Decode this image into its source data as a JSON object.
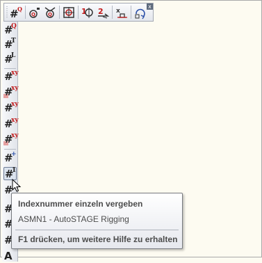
{
  "toolbar_horizontal": {
    "buttons": [
      {
        "name": "index-q-button",
        "hash": "#",
        "sup": "Q"
      },
      {
        "name": "tag-q-button",
        "hash": "",
        "sup": "Q"
      },
      {
        "name": "tag-q-arrow-button",
        "hash": "",
        "sup": "Q"
      },
      {
        "name": "target-button",
        "hash": "",
        "sup": ""
      },
      {
        "name": "number-tag-button",
        "hash": "",
        "sup": ""
      },
      {
        "name": "number-tag-2-button",
        "hash": "",
        "sup": ""
      },
      {
        "name": "axis-tag-button",
        "hash": "",
        "sup": ""
      },
      {
        "name": "refresh-tag-button",
        "hash": "",
        "sup": ""
      }
    ],
    "close_label": "x"
  },
  "toolbar_vertical": {
    "buttons": [
      {
        "hash": "#",
        "sup": "Q",
        "sup_color": "red"
      },
      {
        "hash": "#",
        "sup": "T",
        "sup_color": "dark"
      },
      {
        "hash": "#",
        "sup": "L",
        "sup_color": "dark"
      },
      {
        "hash": "#",
        "sup": "xy",
        "sup_color": "red"
      },
      {
        "hash": "#",
        "sup": "xy",
        "sup_color": "red"
      },
      {
        "hash": "#",
        "sup": "xy",
        "sup_color": "red"
      },
      {
        "hash": "#",
        "sup": "xy",
        "sup_color": "red"
      },
      {
        "hash": "#",
        "sup": "xy",
        "sup_color": "red"
      },
      {
        "hash": "#",
        "sup": "+",
        "sup_color": "blue"
      },
      {
        "hash": "#",
        "sup": "1",
        "sup_color": "dark"
      },
      {
        "hash": "#",
        "sup": "",
        "sup_color": "dark"
      },
      {
        "hash": "#",
        "sup": "",
        "sup_color": "red"
      },
      {
        "hash": "#",
        "sup": "",
        "sup_color": "red"
      },
      {
        "hash": "#",
        "sup": "",
        "sup_color": "red"
      },
      {
        "hash": "A",
        "sup": "",
        "sup_color": "dark"
      }
    ]
  },
  "tooltip": {
    "title": "Indexnummer einzeln vergeben",
    "description": "ASMN1 - AutoSTAGE Rigging",
    "help": "F1 drücken, um weitere Hilfe zu erhalten"
  },
  "colors": {
    "red": "#c21a1a",
    "dark": "#1c1c1c",
    "blue": "#2a4fa8",
    "canvas": "#fdfbf1"
  }
}
